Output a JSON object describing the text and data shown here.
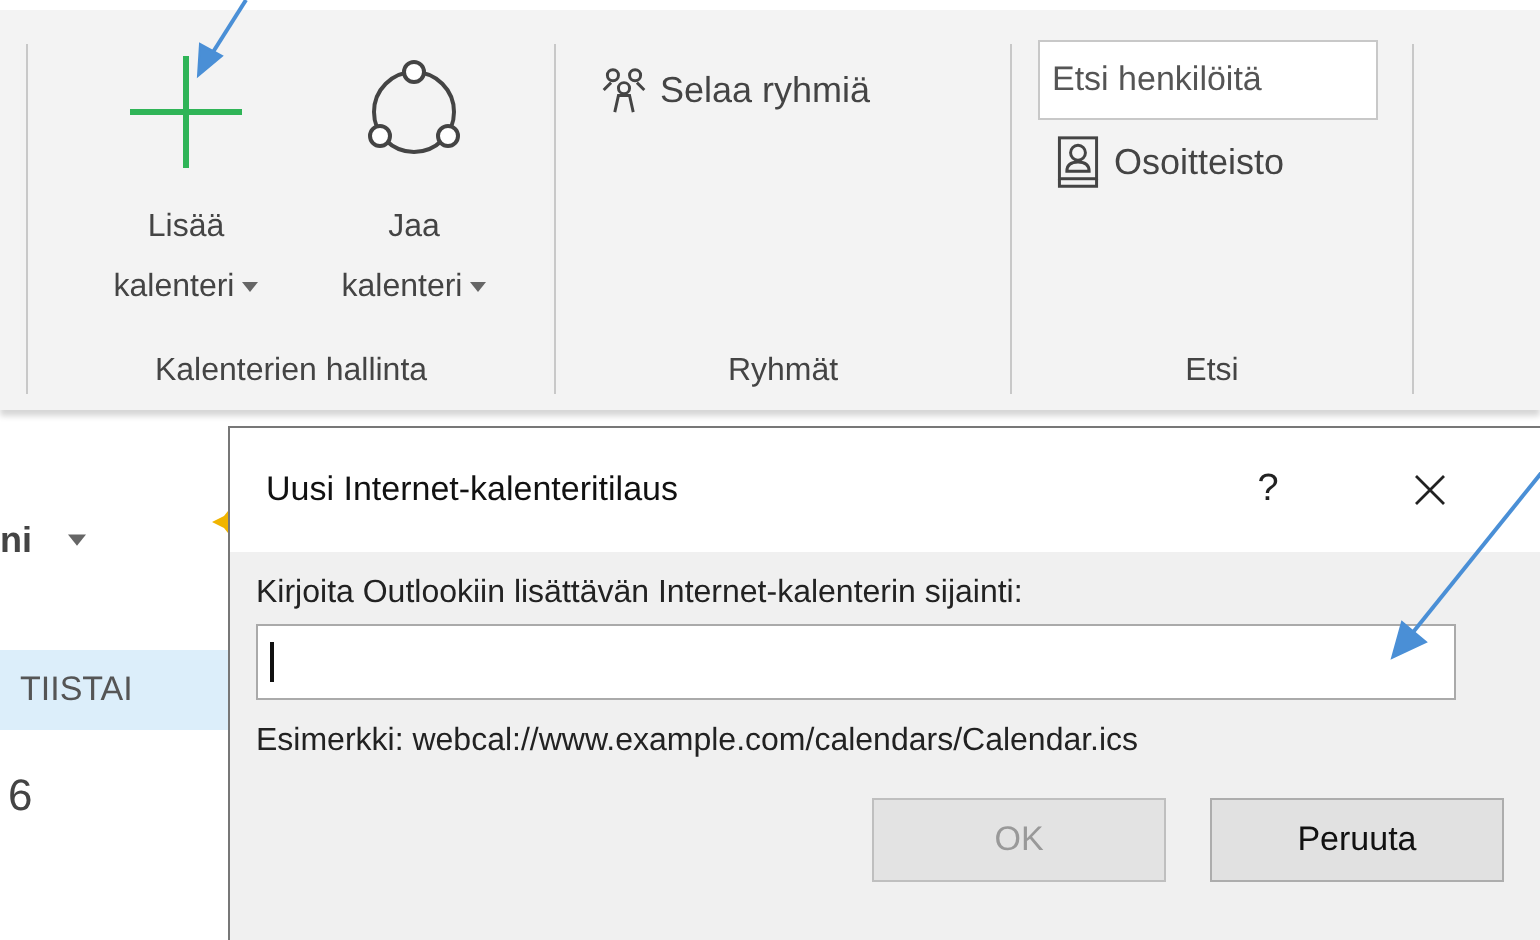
{
  "ribbon": {
    "groups": [
      {
        "label": "Kalenterien hallinta",
        "commands": [
          {
            "kind": "add",
            "lines": [
              "Lisää",
              "kalenteri"
            ],
            "dropdown": true
          },
          {
            "kind": "share",
            "lines": [
              "Jaa",
              "kalenteri"
            ],
            "dropdown": true
          }
        ]
      },
      {
        "label": "Ryhmät",
        "commands": [
          {
            "kind": "groups",
            "lines": [
              "Selaa ryhmiä"
            ],
            "dropdown": false
          }
        ]
      },
      {
        "label": "Etsi",
        "search": {
          "placeholder": "Etsi henkilöitä"
        },
        "commands": [
          {
            "kind": "addressbook",
            "lines": [
              "Osoitteisto"
            ],
            "dropdown": false
          }
        ]
      }
    ]
  },
  "calendar": {
    "view_menu": "ni",
    "day_header": "TIISTAI",
    "day_number": "6"
  },
  "dialog": {
    "title": "Uusi Internet-kalenteritilaus",
    "help": "?",
    "prompt": "Kirjoita Outlookiin lisättävän Internet-kalenterin sijainti:",
    "url_field": {
      "focused": true
    },
    "example": "Esimerkki: webcal://www.example.com/calendars/Calendar.ics",
    "buttons": [
      {
        "label": "OK",
        "disabled": true
      },
      {
        "label": "Peruuta",
        "disabled": false
      }
    ]
  }
}
